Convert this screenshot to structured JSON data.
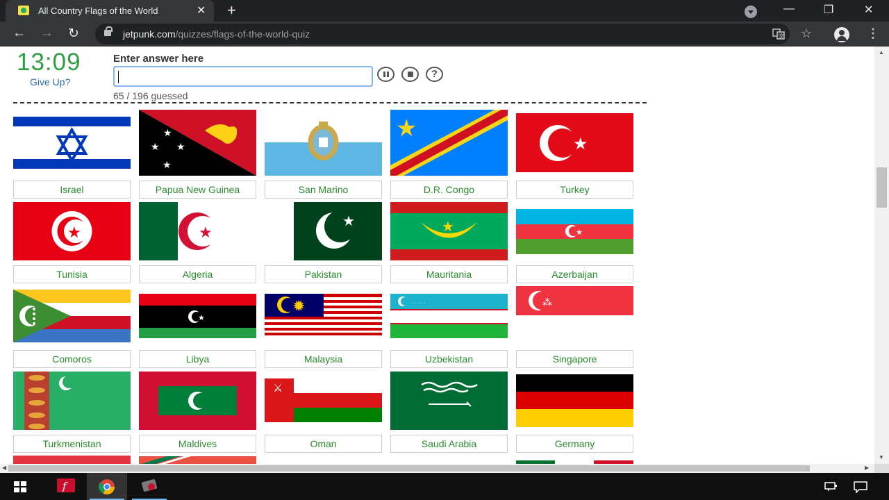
{
  "browser": {
    "tab_title": "All Country Flags of the World",
    "tab_close": "✕",
    "new_tab": "+",
    "url_host": "jetpunk.com",
    "url_path": "/quizzes/flags-of-the-world-quiz",
    "window_controls": {
      "minimize": "—",
      "restore": "❐",
      "close": "✕"
    },
    "nav": {
      "back": "←",
      "forward": "→",
      "reload": "↻"
    },
    "icons": [
      "translate-icon",
      "star-icon",
      "profile-icon",
      "menu-icon"
    ]
  },
  "quiz": {
    "timer": "13:09",
    "give_up": "Give Up?",
    "answer_label": "Enter answer here",
    "answer_value": "",
    "guessed": "65 / 196 guessed",
    "help": "?"
  },
  "flags": [
    {
      "name": "Israel"
    },
    {
      "name": "Papua New Guinea"
    },
    {
      "name": "San Marino"
    },
    {
      "name": "D.R. Congo"
    },
    {
      "name": "Turkey"
    },
    {
      "name": "Tunisia"
    },
    {
      "name": "Algeria"
    },
    {
      "name": "Pakistan"
    },
    {
      "name": "Mauritania"
    },
    {
      "name": "Azerbaijan"
    },
    {
      "name": "Comoros"
    },
    {
      "name": "Libya"
    },
    {
      "name": "Malaysia"
    },
    {
      "name": "Uzbekistan"
    },
    {
      "name": "Singapore"
    },
    {
      "name": "Turkmenistan"
    },
    {
      "name": "Maldives"
    },
    {
      "name": "Oman"
    },
    {
      "name": "Saudi Arabia"
    },
    {
      "name": "Germany"
    }
  ],
  "colors": {
    "accent_green": "#2ea043",
    "link_blue": "#2d6ea8",
    "label_green": "#2b8a2e"
  }
}
